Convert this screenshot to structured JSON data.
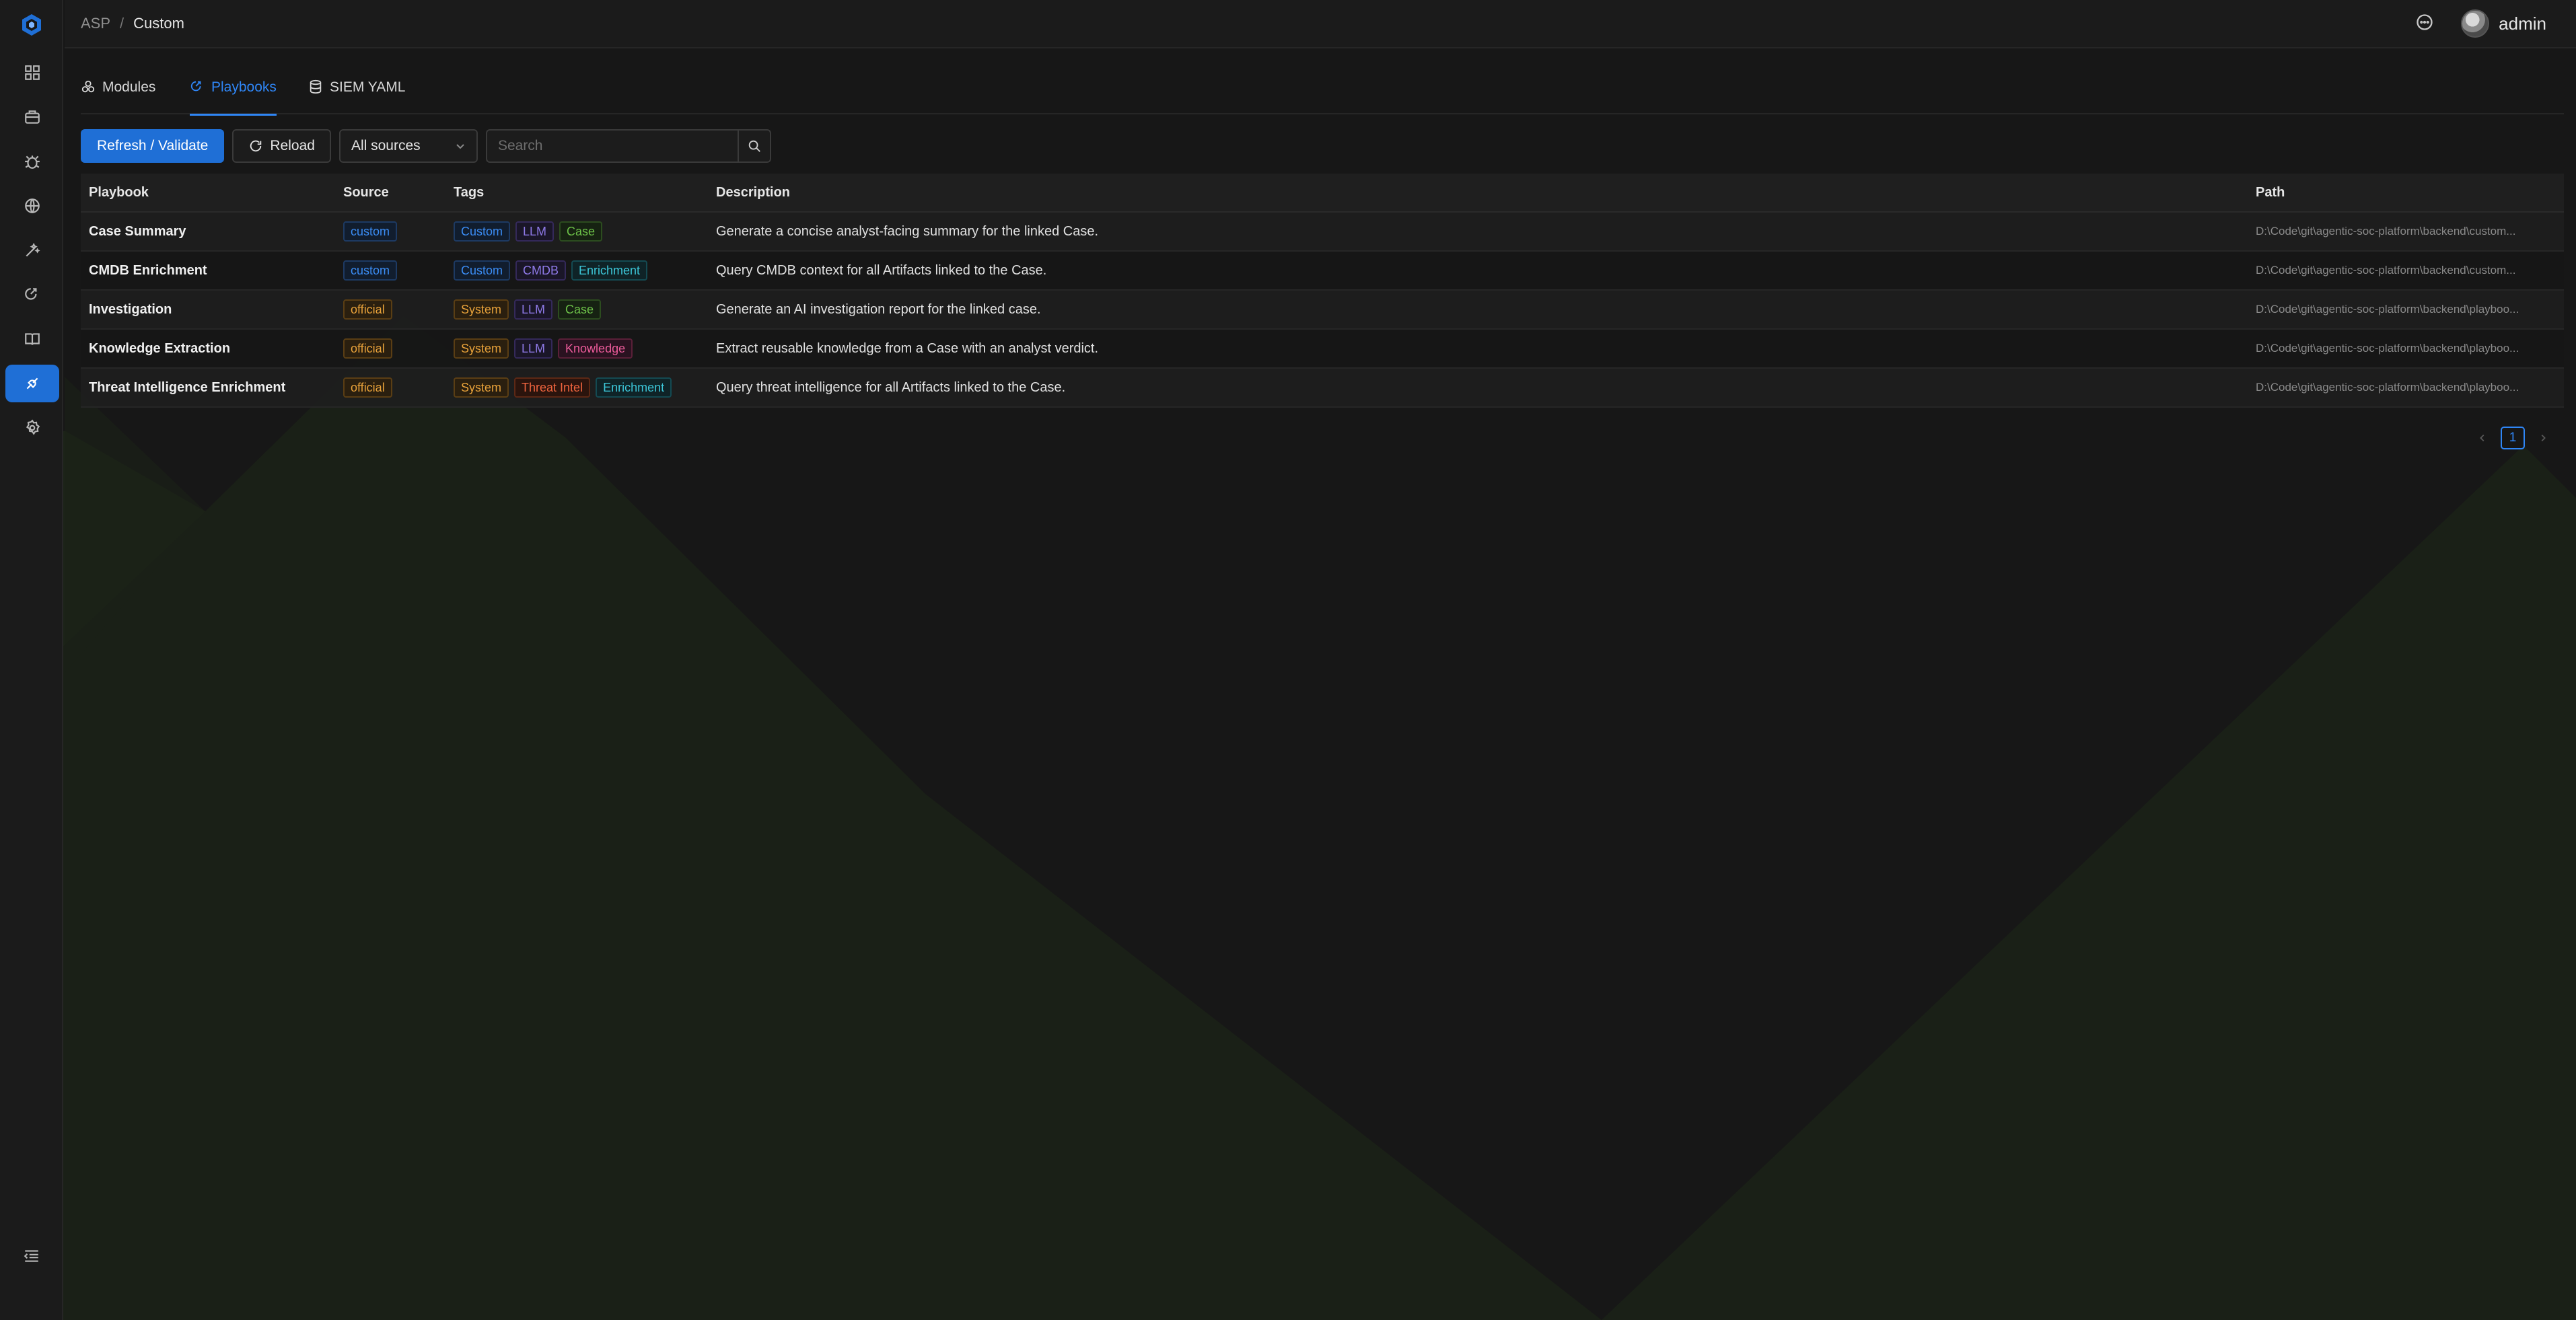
{
  "breadcrumb": {
    "root": "ASP",
    "separator": "/",
    "current": "Custom"
  },
  "header": {
    "username": "admin"
  },
  "sidebar": {
    "items": [
      {
        "name": "dashboard",
        "icon": "grid-icon",
        "active": false
      },
      {
        "name": "cases",
        "icon": "briefcase-icon",
        "active": false
      },
      {
        "name": "alerts",
        "icon": "bug-icon",
        "active": false
      },
      {
        "name": "network",
        "icon": "globe-icon",
        "active": false
      },
      {
        "name": "tools",
        "icon": "wand-icon",
        "active": false
      },
      {
        "name": "playbook-center",
        "icon": "robot-icon",
        "active": false
      },
      {
        "name": "knowledge",
        "icon": "book-icon",
        "active": false
      },
      {
        "name": "custom",
        "icon": "plug-icon",
        "active": true
      },
      {
        "name": "settings",
        "icon": "gear-icon",
        "active": false
      }
    ]
  },
  "tabs": [
    {
      "label": "Modules",
      "active": false
    },
    {
      "label": "Playbooks",
      "active": true
    },
    {
      "label": "SIEM YAML",
      "active": false
    }
  ],
  "toolbar": {
    "refresh_label": "Refresh / Validate",
    "reload_label": "Reload",
    "source_select": "All sources",
    "search_placeholder": "Search"
  },
  "table": {
    "columns": [
      "Playbook",
      "Source",
      "Tags",
      "Description",
      "Path"
    ],
    "rows": [
      {
        "playbook": "Case Summary",
        "source": "custom",
        "tags": [
          {
            "label": "Custom",
            "color": "#3b8df5"
          },
          {
            "label": "LLM",
            "color": "#8f7ae8"
          },
          {
            "label": "Case",
            "color": "#6cc048"
          }
        ],
        "description": "Generate a concise analyst-facing summary for the linked Case.",
        "path": "D:\\Code\\git\\agentic-soc-platform\\backend\\custom..."
      },
      {
        "playbook": "CMDB Enrichment",
        "source": "custom",
        "tags": [
          {
            "label": "Custom",
            "color": "#3b8df5"
          },
          {
            "label": "CMDB",
            "color": "#8f7ae8"
          },
          {
            "label": "Enrichment",
            "color": "#3cc6d8"
          }
        ],
        "description": "Query CMDB context for all Artifacts linked to the Case.",
        "path": "D:\\Code\\git\\agentic-soc-platform\\backend\\custom..."
      },
      {
        "playbook": "Investigation",
        "source": "official",
        "tags": [
          {
            "label": "System",
            "color": "#e8a23a"
          },
          {
            "label": "LLM",
            "color": "#8f7ae8"
          },
          {
            "label": "Case",
            "color": "#6cc048"
          }
        ],
        "description": "Generate an AI investigation report for the linked case.",
        "path": "D:\\Code\\git\\agentic-soc-platform\\backend\\playboo..."
      },
      {
        "playbook": "Knowledge Extraction",
        "source": "official",
        "tags": [
          {
            "label": "System",
            "color": "#e8a23a"
          },
          {
            "label": "LLM",
            "color": "#8f7ae8"
          },
          {
            "label": "Knowledge",
            "color": "#ec5b9a"
          }
        ],
        "description": "Extract reusable knowledge from a Case with an analyst verdict.",
        "path": "D:\\Code\\git\\agentic-soc-platform\\backend\\playboo..."
      },
      {
        "playbook": "Threat Intelligence Enrichment",
        "source": "official",
        "tags": [
          {
            "label": "System",
            "color": "#e8a23a"
          },
          {
            "label": "Threat Intel",
            "color": "#f0643e"
          },
          {
            "label": "Enrichment",
            "color": "#3cc6d8"
          }
        ],
        "description": "Query threat intelligence for all Artifacts linked to the Case.",
        "path": "D:\\Code\\git\\agentic-soc-platform\\backend\\playboo..."
      }
    ]
  },
  "pagination": {
    "current_page": "1"
  },
  "colors": {
    "accent": "#1f6fd6",
    "background": "#171717",
    "mountain": "#1b2217"
  }
}
